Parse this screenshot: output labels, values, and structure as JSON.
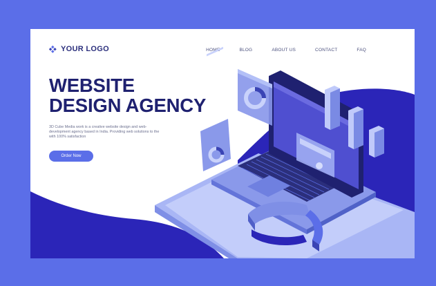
{
  "brand": {
    "logo_text": "YOUR LOGO",
    "logo_icon": "diamond-logo-icon",
    "primary_color": "#5b6ee8",
    "dark_color": "#1f2170",
    "wave_color": "#2b25b8"
  },
  "nav": {
    "items": [
      {
        "label": "HOME"
      },
      {
        "label": "BLOG"
      },
      {
        "label": "ABOUT US"
      },
      {
        "label": "CONTACT"
      },
      {
        "label": "FAQ"
      }
    ]
  },
  "hero": {
    "title_line1": "WEBSITE",
    "title_line2": "DESIGN AGENCY",
    "description": "3D Cube Media work is a creative website design and web-development agency based in India. Providing web solutions to the with 100% satisfaction",
    "cta_label": "Order Now"
  }
}
